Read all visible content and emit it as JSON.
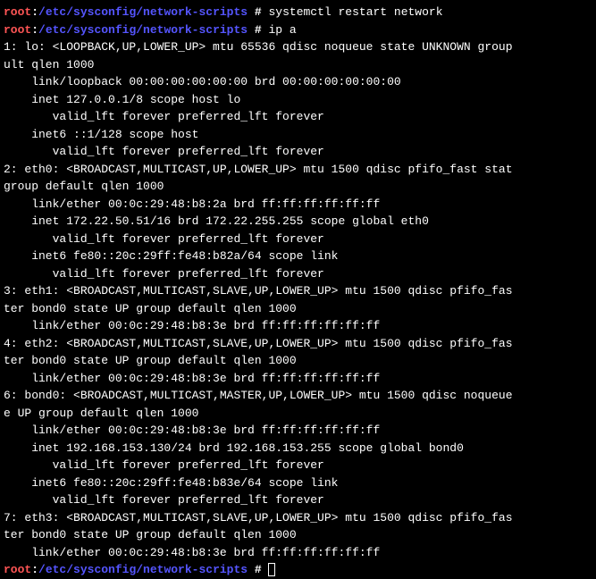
{
  "prompt": {
    "user": "root",
    "colon": ":",
    "path": "/etc/sysconfig/network-scripts",
    "hash": " # "
  },
  "cmd1": "systemctl restart network",
  "cmd2": "ip a",
  "cmd3": "",
  "output": [
    "1: lo: <LOOPBACK,UP,LOWER_UP> mtu 65536 qdisc noqueue state UNKNOWN group",
    "ult qlen 1000",
    "    link/loopback 00:00:00:00:00:00 brd 00:00:00:00:00:00",
    "    inet 127.0.0.1/8 scope host lo",
    "       valid_lft forever preferred_lft forever",
    "    inet6 ::1/128 scope host",
    "       valid_lft forever preferred_lft forever",
    "2: eth0: <BROADCAST,MULTICAST,UP,LOWER_UP> mtu 1500 qdisc pfifo_fast stat",
    "group default qlen 1000",
    "    link/ether 00:0c:29:48:b8:2a brd ff:ff:ff:ff:ff:ff",
    "    inet 172.22.50.51/16 brd 172.22.255.255 scope global eth0",
    "       valid_lft forever preferred_lft forever",
    "    inet6 fe80::20c:29ff:fe48:b82a/64 scope link",
    "       valid_lft forever preferred_lft forever",
    "3: eth1: <BROADCAST,MULTICAST,SLAVE,UP,LOWER_UP> mtu 1500 qdisc pfifo_fas",
    "ter bond0 state UP group default qlen 1000",
    "    link/ether 00:0c:29:48:b8:3e brd ff:ff:ff:ff:ff:ff",
    "4: eth2: <BROADCAST,MULTICAST,SLAVE,UP,LOWER_UP> mtu 1500 qdisc pfifo_fas",
    "ter bond0 state UP group default qlen 1000",
    "    link/ether 00:0c:29:48:b8:3e brd ff:ff:ff:ff:ff:ff",
    "6: bond0: <BROADCAST,MULTICAST,MASTER,UP,LOWER_UP> mtu 1500 qdisc noqueue",
    "e UP group default qlen 1000",
    "    link/ether 00:0c:29:48:b8:3e brd ff:ff:ff:ff:ff:ff",
    "    inet 192.168.153.130/24 brd 192.168.153.255 scope global bond0",
    "       valid_lft forever preferred_lft forever",
    "    inet6 fe80::20c:29ff:fe48:b83e/64 scope link",
    "       valid_lft forever preferred_lft forever",
    "7: eth3: <BROADCAST,MULTICAST,SLAVE,UP,LOWER_UP> mtu 1500 qdisc pfifo_fas",
    "ter bond0 state UP group default qlen 1000",
    "    link/ether 00:0c:29:48:b8:3e brd ff:ff:ff:ff:ff:ff"
  ]
}
